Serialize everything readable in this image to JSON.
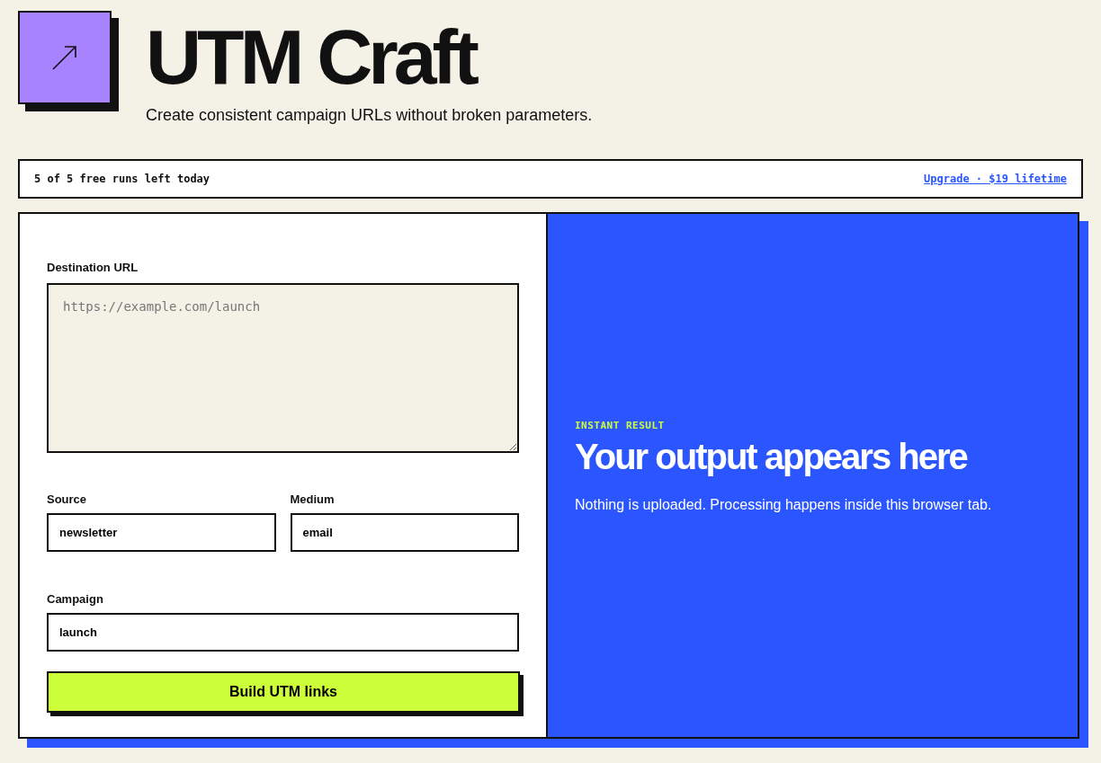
{
  "header": {
    "title": "UTM Craft",
    "subtitle": "Create consistent campaign URLs without broken parameters."
  },
  "banner": {
    "runs_left": "5 of 5 free runs left today",
    "upgrade_link": "Upgrade · $19 lifetime"
  },
  "form": {
    "destination": {
      "label": "Destination URL",
      "placeholder": "https://example.com/launch"
    },
    "row_fields": [
      {
        "label": "Source",
        "value": "newsletter"
      },
      {
        "label": "Medium",
        "value": "email"
      }
    ],
    "campaign": {
      "label": "Campaign",
      "value": "launch"
    },
    "submit": "Build UTM links"
  },
  "result": {
    "eyebrow": "INSTANT RESULT",
    "heading": "Your output appears here",
    "note": "Nothing is uploaded. Processing happens inside this browser tab."
  }
}
